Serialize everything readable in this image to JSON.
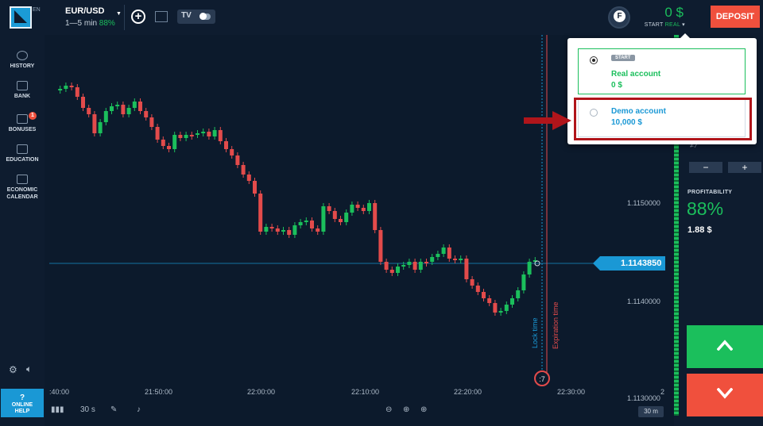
{
  "header": {
    "language": "EN",
    "asset_name": "EUR/USD",
    "asset_timeframe": "1—5 min",
    "asset_payout": "88%",
    "tv_label": "TV",
    "balance": "0 $",
    "account_start": "START",
    "account_type": "REAL",
    "deposit_label": "DEPOSIT",
    "avatar_letter": "F"
  },
  "sidebar": {
    "items": [
      {
        "label": "HISTORY"
      },
      {
        "label": "BANK"
      },
      {
        "label": "BONUSES",
        "badge": "1"
      },
      {
        "label": "EDUCATION"
      },
      {
        "label": "ECONOMIC",
        "label2": "CALENDAR"
      }
    ],
    "help_line1": "ONLINE",
    "help_line2": "HELP"
  },
  "chart": {
    "prices": [
      "1.1150000",
      "1.1140000",
      "1.1130000"
    ],
    "times": [
      ":40:00",
      "21:50:00",
      "22:00:00",
      "22:10:00",
      "22:20:00",
      "22:30:00"
    ],
    "current_price": "1.1143850",
    "lock_time_label": "Lock time",
    "expiration_label": "Expiration time",
    "countdown": ":7",
    "edge_digit": "2",
    "timeframe_button": "30 m",
    "interval_label": "30 s",
    "up_color": "#1bbf5c",
    "down_color": "#e34b4b"
  },
  "right_panel": {
    "profitability_label": "PROFITABILITY",
    "profitability_pct": "88%",
    "profitability_amount": "1.88 $",
    "minus_label": "−",
    "plus_label": "+",
    "partial_text": "≠ ⁄"
  },
  "dropdown": {
    "real": {
      "badge": "START",
      "name": "Real account",
      "balance": "0 $"
    },
    "demo": {
      "name": "Demo account",
      "balance": "10,000 $"
    }
  }
}
